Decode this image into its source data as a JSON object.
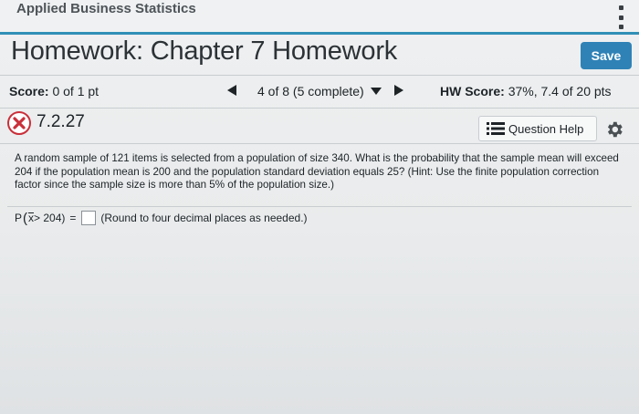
{
  "course": {
    "title": "Applied Business Statistics"
  },
  "homework": {
    "title": "Homework: Chapter 7 Homework",
    "save_label": "Save"
  },
  "scorebar": {
    "score_label": "Score:",
    "score_value": "0 of 1 pt",
    "progress": "4 of 8 (5 complete)",
    "hw_score_label": "HW Score:",
    "hw_score_value": "37%, 7.4 of 20 pts"
  },
  "question": {
    "number": "7.2.27",
    "help_label": "Question Help",
    "text": "A random sample of 121 items is selected from a population of size 340. What is the probability that the sample mean will exceed 204 if the population mean is 200 and the population standard deviation equals 25? (Hint: Use the finite population correction factor since the sample size is more than 5% of the population size.)",
    "answer_prefix_p": "P",
    "answer_x": "x",
    "answer_condition": "> 204)",
    "answer_equals": "=",
    "answer_value": "",
    "round_note": "(Round to four decimal places as needed.)"
  },
  "colors": {
    "accent": "#2f82b6",
    "wrong": "#c9303a"
  }
}
